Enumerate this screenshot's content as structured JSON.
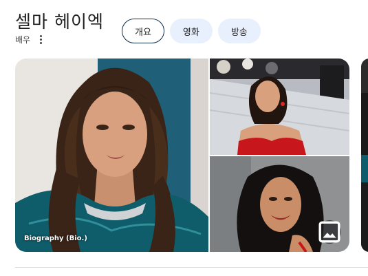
{
  "header": {
    "title": "셀마 헤이엑",
    "subtitle": "배우"
  },
  "chips": [
    {
      "label": "개요",
      "active": true
    },
    {
      "label": "영화",
      "active": false
    },
    {
      "label": "방송",
      "active": false
    }
  ],
  "photos": {
    "main_caption": "Biography (Bio.)"
  },
  "icons": {
    "more": "more-vert-icon",
    "gallery": "image-gallery-icon"
  },
  "colors": {
    "chip_bg": "#e8f0fe",
    "chip_active_border": "#0b2a4a",
    "dress_red": "#c8161d",
    "teal_bg": "#1f5f78"
  }
}
